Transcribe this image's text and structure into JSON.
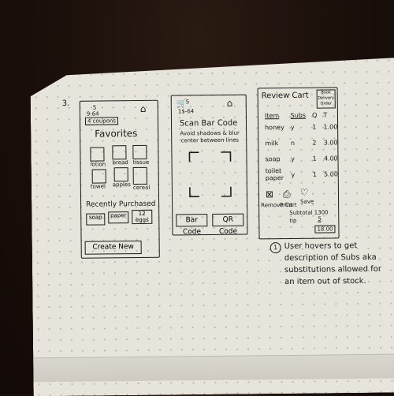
{
  "page_number": "3.",
  "screen1": {
    "points": "5",
    "info": "9:64",
    "coupons": "4 coupons",
    "title": "Favorites",
    "recent_title": "Recently Purchased",
    "recent_items": [
      "soap",
      "paper",
      "12 eggs"
    ],
    "fav_labels": [
      "lotion",
      "bread",
      "tissue",
      "towel",
      "apples",
      "cereal"
    ],
    "create_new": "Create New"
  },
  "screen2": {
    "points": "5",
    "info": "1$-64",
    "title": "Scan Bar Code",
    "hint": "Avoid shadows & blur center between lines",
    "barcode_button": "Bar Code",
    "qrcode_button": "QR Code"
  },
  "screen3": {
    "title": "Review Cart",
    "header_buttons": [
      "Book",
      "Delivery",
      "Order"
    ],
    "col_item": "Item",
    "col_subs": "Subs",
    "col_q": "Q",
    "col_t": "T",
    "rows": [
      {
        "item": "honey",
        "sub": "y",
        "q": "1",
        "t": "1.00"
      },
      {
        "item": "milk",
        "sub": "n",
        "q": "2",
        "t": "3.00"
      },
      {
        "item": "soap",
        "sub": "y",
        "q": "1",
        "t": "4.00"
      },
      {
        "item": "toilet paper",
        "sub": "y",
        "q": "1",
        "t": "5.00"
      }
    ],
    "action_remove": "Remove Cart",
    "action_print": "Print",
    "action_save": "Save",
    "subtotal": "Subtotal 1300",
    "tip": "tip",
    "tip_value": "5",
    "total": "18.00"
  },
  "note": {
    "marker": "1",
    "text": "User hovers to get description of Subs aka substitutions allowed for an item out of stock."
  }
}
